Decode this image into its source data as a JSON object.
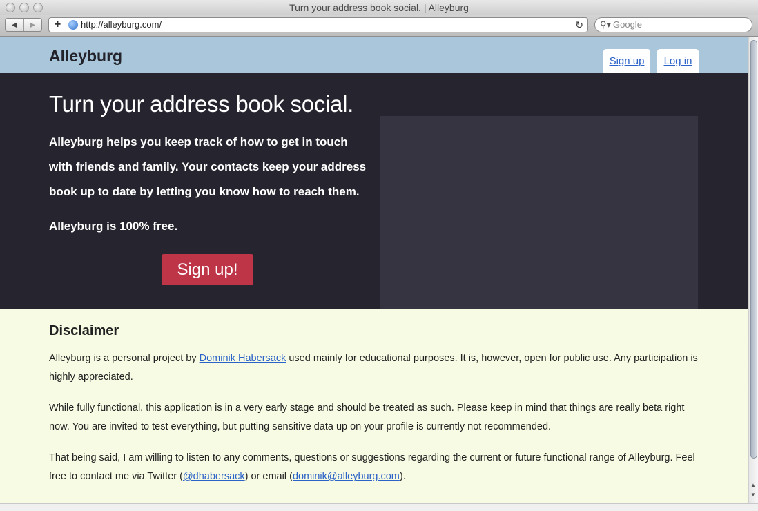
{
  "window": {
    "title": "Turn your address book social. | Alleyburg"
  },
  "toolbar": {
    "url": "http://alleyburg.com/",
    "search_placeholder": "Google"
  },
  "header": {
    "brand": "Alleyburg",
    "signup_tab": "Sign up",
    "login_tab": "Log in"
  },
  "hero": {
    "headline": "Turn your address book social.",
    "lead": "Alleyburg helps you keep track of how to get in touch with friends and family. Your contacts keep your address book up to date by letting you know how to reach them.",
    "free": "Alleyburg is 100% free.",
    "cta": "Sign up!"
  },
  "disclaimer": {
    "heading": "Disclaimer",
    "p1_before": "Alleyburg is a personal project by ",
    "p1_link": "Dominik Habersack",
    "p1_after": " used mainly for educational purposes. It is, however, open for public use. Any participation is highly appreciated.",
    "p2": "While fully functional, this application is in a very early stage and should be treated as such. Please keep in mind that things are really beta right now. You are invited to test everything, but putting sensitive data up on your profile is currently not recommended.",
    "p3_before": "That being said, I am willing to listen to any comments, questions or suggestions regarding the current or future functional range of Alleyburg. Feel free to contact me via Twitter (",
    "p3_twitter": "@dhabersack",
    "p3_mid": ") or email (",
    "p3_email": "dominik@alleyburg.com",
    "p3_after": ")."
  },
  "colors": {
    "header_bg": "#a9c6da",
    "hero_bg": "#26252f",
    "cta_bg": "#bd3547",
    "footer_bg": "#f8fbe3",
    "link": "#2c63c8"
  }
}
